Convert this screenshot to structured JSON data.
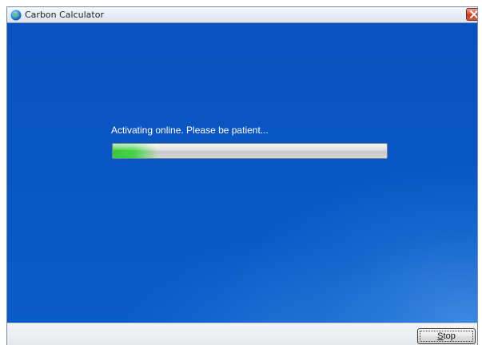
{
  "window": {
    "title": "Carbon Calculator",
    "icon": "globe-icon",
    "close_icon": "close-icon"
  },
  "main": {
    "status_text": "Activating online. Please be patient...",
    "progress": {
      "fraction": 0.17,
      "color": "#46d246"
    },
    "background_color": "#0a56c3"
  },
  "footer": {
    "stop_accel": "S",
    "stop_rest": "top"
  },
  "colors": {
    "close_button": "#d9573c",
    "progress_fill": "#46d246"
  }
}
